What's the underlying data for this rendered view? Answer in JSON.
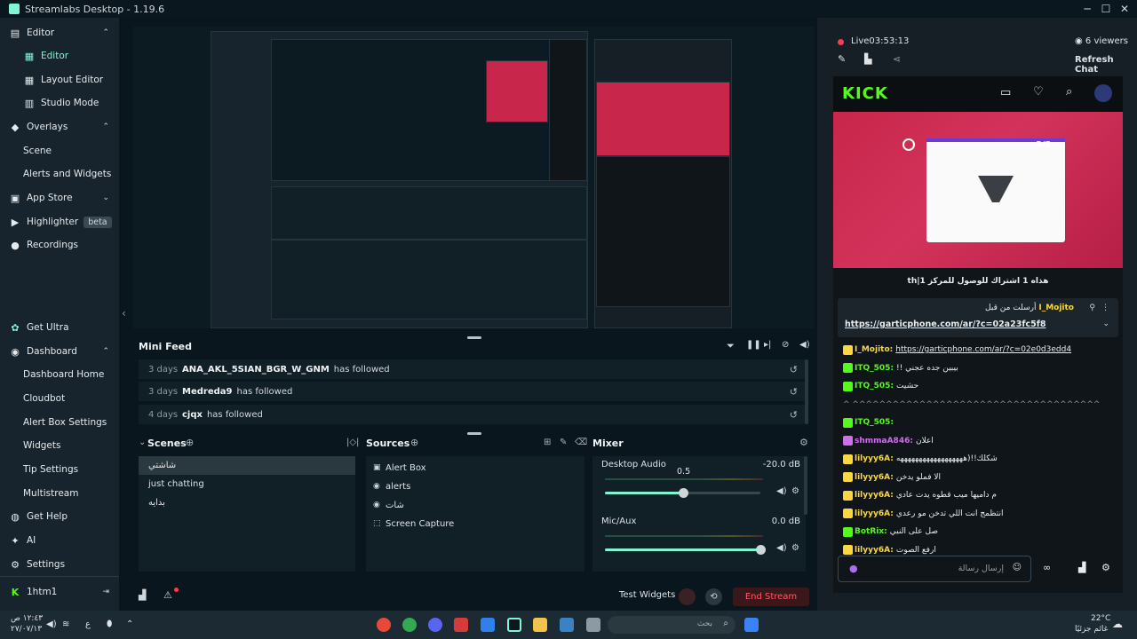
{
  "window": {
    "title": "Streamlabs Desktop - 1.19.6",
    "minimize": "─",
    "maximize": "☐",
    "close": "✕"
  },
  "sidebar": {
    "items": [
      {
        "label": "Editor",
        "icon": "editor-icon",
        "chevron": "⌃"
      },
      {
        "label": "Editor",
        "icon": "editor-sub-icon",
        "active": true
      },
      {
        "label": "Layout Editor",
        "icon": "layout-icon"
      },
      {
        "label": "Studio Mode",
        "icon": "studio-icon"
      },
      {
        "label": "Overlays",
        "icon": "overlays-icon",
        "chevron": "⌃"
      },
      {
        "label": "Scene"
      },
      {
        "label": "Alerts and Widgets"
      },
      {
        "label": "App Store",
        "icon": "app-store-icon",
        "chevron": "⌄"
      },
      {
        "label": "Highlighter",
        "icon": "highlighter-icon",
        "badge": "beta"
      },
      {
        "label": "Recordings",
        "icon": "recordings-icon"
      }
    ],
    "bottom_items": [
      {
        "label": "Get Ultra",
        "icon": "ultra-icon"
      },
      {
        "label": "Dashboard",
        "icon": "dashboard-icon",
        "chevron": "⌃"
      },
      {
        "label": "Dashboard Home"
      },
      {
        "label": "Cloudbot"
      },
      {
        "label": "Alert Box Settings"
      },
      {
        "label": "Widgets"
      },
      {
        "label": "Tip Settings"
      },
      {
        "label": "Multistream"
      },
      {
        "label": "Get Help",
        "icon": "help-icon"
      },
      {
        "label": "AI",
        "icon": "ai-icon"
      },
      {
        "label": "Settings",
        "icon": "settings-icon"
      }
    ],
    "user": {
      "name": "1htm1",
      "logout_icon": "logout-icon"
    }
  },
  "minifeed": {
    "title": "Mini Feed",
    "rows": [
      {
        "days": "3 days",
        "user": "ANA_AKL_5SIAN_BGR_W_GNM",
        "action": "has followed"
      },
      {
        "days": "3 days",
        "user": "Medreda9",
        "action": "has followed"
      },
      {
        "days": "4 days",
        "user": "cjqx",
        "action": "has followed"
      }
    ]
  },
  "scenes": {
    "title": "Scenes",
    "items": [
      "شاشتي",
      "just chatting",
      "بدايه"
    ],
    "selected": 0
  },
  "sources": {
    "title": "Sources",
    "items": [
      {
        "label": "Alert Box",
        "icon": "alert-box-icon"
      },
      {
        "label": "alerts",
        "icon": "globe-icon"
      },
      {
        "label": "شات",
        "icon": "globe-icon"
      },
      {
        "label": "Screen Capture",
        "icon": "screen-capture-icon"
      }
    ]
  },
  "mixer": {
    "title": "Mixer",
    "channels": [
      {
        "name": "Desktop Audio",
        "db": "-20.0 dB",
        "level": 0.5,
        "level_label": "0.5"
      },
      {
        "name": "Mic/Aux",
        "db": "0.0 dB",
        "level": 1.0
      }
    ]
  },
  "footer": {
    "test_widgets": "Test Widgets",
    "end_stream": "End Stream"
  },
  "live": {
    "status": "Live",
    "time": "03:53:13",
    "viewers": "6 viewers",
    "refresh_chat": "Refresh Chat"
  },
  "kick": {
    "logo": "KICK",
    "stream_caption": "th|هذاه 1 اشتراك للوصول للمركز 1",
    "pinned": {
      "user": "I_Mojito",
      "label": "أرسلت من قبل",
      "link": "https://garticphone.com/ar/?c=02a23fc5f8"
    },
    "messages": [
      {
        "user": "I_Mojito",
        "text": "https://garticphone.com/ar/?c=02e0d3edd4",
        "color": "#fbd63c"
      },
      {
        "user": "ITQ_505",
        "text": "!! بيبين جده عجني",
        "color": "#53fc18"
      },
      {
        "user": "ITQ_505",
        "text": "حشيت",
        "color": "#53fc18"
      },
      {
        "user": "",
        "text": "^ ^^^^^^^^^^^^^^^^^^^^^^^^^^^^^^^^^^^^^",
        "color": "#8e9aa1"
      },
      {
        "user": "ITQ_505",
        "text": "",
        "color": "#53fc18"
      },
      {
        "user": "shmmaA846",
        "text": "اعلان",
        "color": "#d46cf0"
      },
      {
        "user": "lilyyy6A",
        "text": "شكلك!!(ههههههههههههههههههه",
        "color": "#fbd63c"
      },
      {
        "user": "lilyyy6A",
        "text": "الا فملو يدخن",
        "color": "#fbd63c"
      },
      {
        "user": "lilyyy6A",
        "text": "م داميها ميب قطوه يدت عادي",
        "color": "#fbd63c"
      },
      {
        "user": "lilyyy6A",
        "text": "انتظمج انت اللي تدخن مو رعدي",
        "color": "#fbd63c"
      },
      {
        "user": "BotRix",
        "text": "صل على النبي",
        "color": "#53fc18"
      },
      {
        "user": "lilyyy6A",
        "text": "ارفع الصوت",
        "color": "#fbd63c"
      }
    ],
    "input_placeholder": "إرسال رسالة"
  },
  "taskbar": {
    "search_placeholder": "بحث",
    "time": "١٢:٤٣ ص",
    "date": "٢٧/٠٧/١٣",
    "lang": "ع",
    "weather_temp": "22°C",
    "weather_desc": "غائم جزئيًا"
  },
  "colors": {
    "accent": "#80f5d2",
    "kick_green": "#53fc18",
    "end_stream": "#ff5a6a",
    "live_dot": "#ff3b4e"
  }
}
